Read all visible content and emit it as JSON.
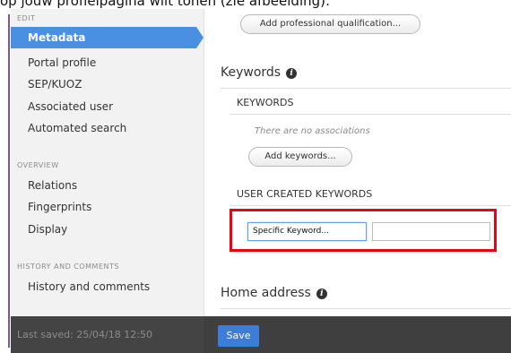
{
  "caption": "op jouw profielpagina wilt tonen (zie afbeelding):",
  "sidebar": {
    "sections": [
      {
        "title": "EDIT",
        "items": [
          "Metadata",
          "Portal profile",
          "SEP/KUOZ",
          "Associated user",
          "Automated search"
        ]
      },
      {
        "title": "OVERVIEW",
        "items": [
          "Relations",
          "Fingerprints",
          "Display"
        ]
      },
      {
        "title": "HISTORY AND COMMENTS",
        "items": [
          "History and comments"
        ]
      }
    ],
    "active_item": "Metadata",
    "last_saved": "Last saved: 25/04/18 12:50"
  },
  "footer": {
    "save_label": "Save"
  },
  "main": {
    "add_qualification_label": "Add professional qualification...",
    "keywords_heading": "Keywords",
    "keywords_subheading": "KEYWORDS",
    "no_associations": "There are no associations",
    "add_keywords_label": "Add keywords...",
    "user_keywords_subheading": "USER CREATED KEYWORDS",
    "keyword_input_value": "Specific Keyword...",
    "keyword_input2_value": "",
    "home_address_heading": "Home address"
  },
  "colors": {
    "accent": "#4a90e2",
    "highlight_box": "#e30613",
    "footer": "#3f3f3f"
  }
}
